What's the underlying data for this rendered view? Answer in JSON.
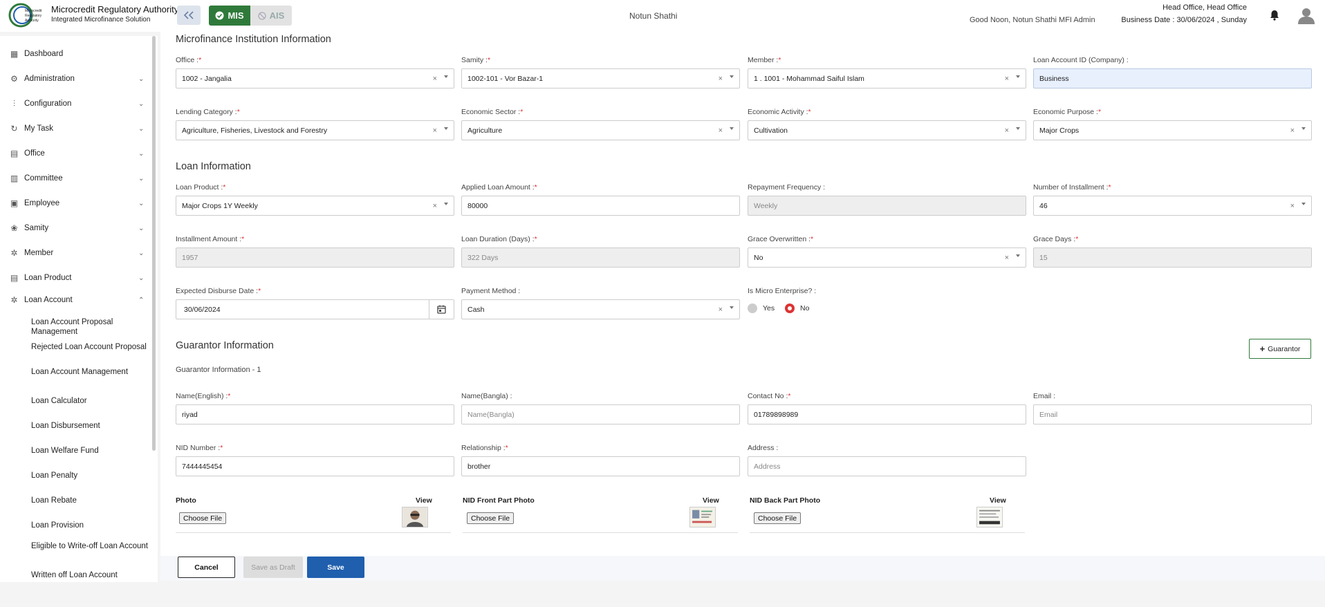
{
  "header": {
    "org_name": "Microcredit Regulatory Authority",
    "org_sub": "Integrated Microfinance Solution",
    "logo_text": "Microcredit Regulatory Authority",
    "mis_label": "MIS",
    "ais_label": "AIS",
    "mfi_name": "Notun Shathi",
    "greeting": "Good Noon, Notun Shathi MFI Admin",
    "head_office": "Head Office, Head Office",
    "business_date": "Business Date : 30/06/2024 , Sunday"
  },
  "sidebar": {
    "items": [
      {
        "label": "Dashboard",
        "icon": "grid-icon"
      },
      {
        "label": "Administration",
        "icon": "users-gear-icon"
      },
      {
        "label": "Configuration",
        "icon": "sliders-icon"
      },
      {
        "label": "My Task",
        "icon": "refresh-icon"
      },
      {
        "label": "Office",
        "icon": "building-icon"
      },
      {
        "label": "Committee",
        "icon": "document-icon"
      },
      {
        "label": "Employee",
        "icon": "id-card-icon"
      },
      {
        "label": "Samity",
        "icon": "group-icon"
      },
      {
        "label": "Member",
        "icon": "member-icon"
      },
      {
        "label": "Loan Product",
        "icon": "box-icon"
      },
      {
        "label": "Loan Account",
        "icon": "account-icon"
      }
    ],
    "sub_items": [
      "Loan Account Proposal Management",
      "Rejected Loan Account Proposal",
      "Loan Account Management",
      "Loan Calculator",
      "Loan Disbursement",
      "Loan Welfare Fund",
      "Loan Penalty",
      "Loan Rebate",
      "Loan Provision",
      "Eligible to Write-off Loan Account",
      "Written off Loan Account"
    ]
  },
  "mfi_section": {
    "title": "Microfinance Institution Information",
    "office": {
      "label": "Office :",
      "value": "1002 - Jangalia"
    },
    "samity": {
      "label": "Samity :",
      "value": "1002-101 - Vor Bazar-1"
    },
    "member": {
      "label": "Member :",
      "value": "1 . 1001 - Mohammad Saiful Islam"
    },
    "loan_account_id": {
      "label": "Loan Account ID (Company) :",
      "value": "Business"
    },
    "lending_category": {
      "label": "Lending Category :",
      "value": "Agriculture, Fisheries, Livestock and Forestry"
    },
    "economic_sector": {
      "label": "Economic Sector :",
      "value": "Agriculture"
    },
    "economic_activity": {
      "label": "Economic Activity :",
      "value": "Cultivation"
    },
    "economic_purpose": {
      "label": "Economic Purpose :",
      "value": "Major Crops"
    }
  },
  "loan_section": {
    "title": "Loan Information",
    "loan_product": {
      "label": "Loan Product :",
      "value": "Major Crops 1Y Weekly"
    },
    "applied_amount": {
      "label": "Applied Loan Amount :",
      "value": "80000"
    },
    "repayment_frequency": {
      "label": "Repayment Frequency :",
      "value": "Weekly"
    },
    "installments": {
      "label": "Number of Installment :",
      "value": "46"
    },
    "installment_amount": {
      "label": "Installment Amount :",
      "value": "1957"
    },
    "loan_duration": {
      "label": "Loan Duration (Days) :",
      "value": "322 Days"
    },
    "grace_overwritten": {
      "label": "Grace Overwritten :",
      "value": "No"
    },
    "grace_days": {
      "label": "Grace Days :",
      "value": "15"
    },
    "disburse_date": {
      "label": "Expected Disburse Date :",
      "value": "30/06/2024"
    },
    "payment_method": {
      "label": "Payment Method :",
      "value": "Cash"
    },
    "micro_enterprise": {
      "label": "Is Micro Enterprise? :",
      "yes": "Yes",
      "no": "No",
      "selected": "No"
    }
  },
  "guarantor_section": {
    "title": "Guarantor Information",
    "add_button": "Guarantor",
    "subtitle": "Guarantor Information - 1",
    "name_en": {
      "label": "Name(English) :",
      "value": "riyad"
    },
    "name_bn": {
      "label": "Name(Bangla) :",
      "placeholder": "Name(Bangla)"
    },
    "contact": {
      "label": "Contact No :",
      "value": "01789898989"
    },
    "email": {
      "label": "Email :",
      "placeholder": "Email"
    },
    "nid": {
      "label": "NID Number :",
      "value": "7444445454"
    },
    "relationship": {
      "label": "Relationship :",
      "value": "brother"
    },
    "address": {
      "label": "Address :",
      "placeholder": "Address"
    },
    "photo": {
      "label": "Photo",
      "view": "View",
      "choose": "Choose File"
    },
    "nid_front": {
      "label": "NID Front Part Photo",
      "view": "View",
      "choose": "Choose File"
    },
    "nid_back": {
      "label": "NID Back Part Photo",
      "view": "View",
      "choose": "Choose File"
    }
  },
  "actions": {
    "cancel": "Cancel",
    "save_draft": "Save as Draft",
    "save": "Save"
  },
  "colors": {
    "accent_green": "#2f7a3a",
    "primary_blue": "#1f5fae",
    "required_red": "#d33333"
  }
}
